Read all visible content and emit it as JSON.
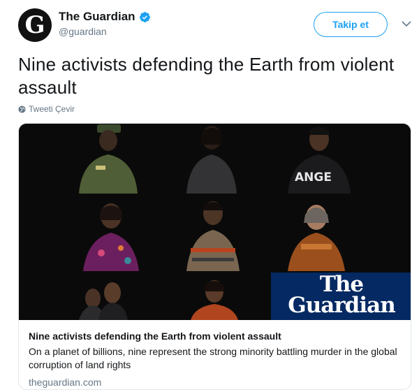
{
  "author": {
    "display_name": "The Guardian",
    "handle": "@guardian",
    "avatar_letter": "G",
    "verified": true
  },
  "actions": {
    "follow_label": "Takip et"
  },
  "tweet": {
    "text": "Nine activists defending the Earth from violent assault",
    "translate_label": "Tweeti Çevir"
  },
  "card": {
    "image_shirt_text": "ANGE",
    "logo_line1": "The",
    "logo_line2": "Guardian",
    "title": "Nine activists defending the Earth from violent assault",
    "description": "On a planet of billions, nine represent the strong minority battling murder in the global corruption of land rights",
    "domain": "theguardian.com"
  },
  "colors": {
    "accent": "#1da1f2",
    "guardian_blue": "#052962",
    "text_primary": "#14171a",
    "text_secondary": "#657786"
  },
  "icons": [
    "verified-badge-icon",
    "chevron-down-icon",
    "globe-icon"
  ]
}
